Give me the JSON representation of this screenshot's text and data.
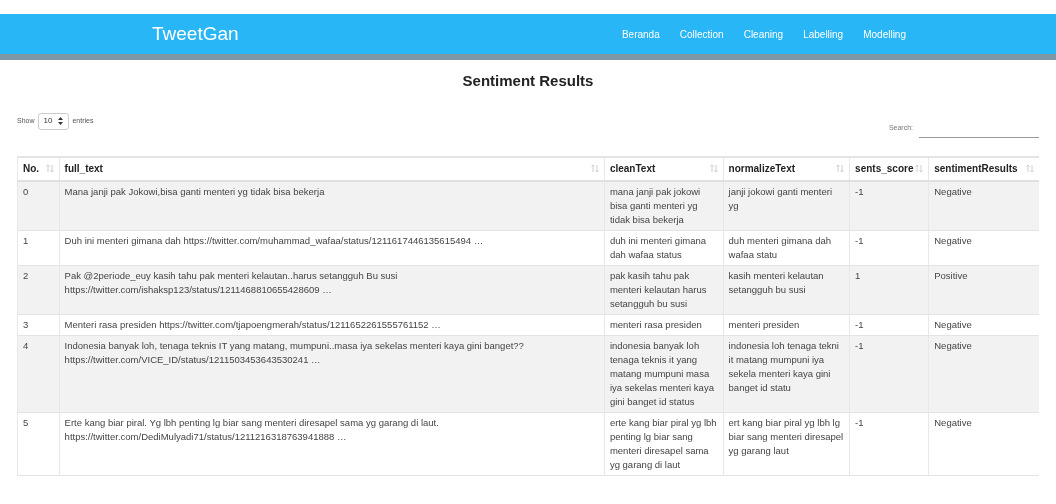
{
  "navbar": {
    "brand": "TweetGan",
    "links": [
      "Beranda",
      "Collection",
      "Cleaning",
      "Labelling",
      "Modelling"
    ]
  },
  "page_title": "Sentiment Results",
  "length_control": {
    "before": "Show",
    "value": "10",
    "after": "entries"
  },
  "search": {
    "label": "Search:"
  },
  "table": {
    "columns": [
      "No.",
      "full_text",
      "cleanText",
      "normalizeText",
      "sents_score",
      "sentimentResults"
    ],
    "rows": [
      [
        "0",
        "Mana janji pak Jokowi,bisa ganti menteri yg tidak bisa bekerja",
        "mana janji pak jokowi bisa ganti menteri yg tidak bisa bekerja",
        "janji jokowi ganti menteri yg",
        "-1",
        "Negative"
      ],
      [
        "1",
        "Duh ini menteri gimana dah https://twitter.com/muhammad_wafaa/status/1211617446135615494 …",
        "duh ini menteri gimana dah wafaa status",
        "duh menteri gimana dah wafaa statu",
        "-1",
        "Negative"
      ],
      [
        "2",
        "Pak @2periode_euy kasih tahu pak menteri kelautan..harus setangguh Bu susi https://twitter.com/ishaksp123/status/1211468810655428609 …",
        "pak kasih tahu pak menteri kelautan harus setangguh bu susi",
        "kasih menteri kelautan setangguh bu susi",
        "1",
        "Positive"
      ],
      [
        "3",
        "Menteri rasa presiden https://twitter.com/tjapoengmerah/status/1211652261555761152 …",
        "menteri rasa presiden",
        "menteri presiden",
        "-1",
        "Negative"
      ],
      [
        "4",
        "Indonesia banyak loh, tenaga teknis IT yang matang, mumpuni..masa iya sekelas menteri kaya gini banget?? https://twitter.com/VICE_ID/status/1211503453643530241 …",
        "indonesia banyak loh tenaga teknis it yang matang mumpuni masa iya sekelas menteri kaya gini banget id status",
        "indonesia loh tenaga tekni it matang mumpuni iya sekela menteri kaya gini banget id statu",
        "-1",
        "Negative"
      ],
      [
        "5",
        "Erte kang biar piral. Yg lbh penting lg biar sang menteri diresapel sama yg garang di laut. https://twitter.com/DediMulyadi71/status/1211216318763941888 …",
        "erte kang biar piral yg lbh penting lg biar sang menteri diresapel sama yg garang di laut",
        "ert kang biar piral yg lbh lg biar sang menteri diresapel yg garang laut",
        "-1",
        "Negative"
      ]
    ]
  }
}
